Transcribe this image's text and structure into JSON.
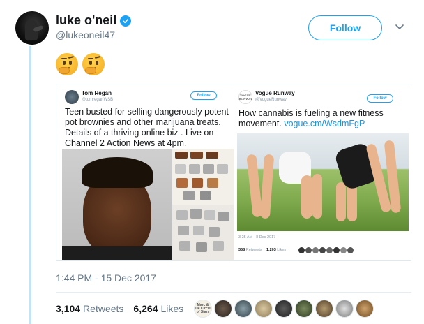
{
  "tweet": {
    "author_name": "luke o'neil",
    "author_handle": "@lukeoneil47",
    "follow_label": "Follow",
    "emojis": [
      "🤔",
      "🤔"
    ],
    "timestamp": "1:44 PM - 15 Dec 2017",
    "retweets_count": "3,104",
    "retweets_label": "Retweets",
    "likes_count": "6,264",
    "likes_label": "Likes",
    "liker_avatars": [
      "Marc & De Circle of Stars",
      "",
      "",
      "",
      "",
      "",
      "",
      "",
      "",
      ""
    ]
  },
  "embedded_left": {
    "name": "Tom Regan",
    "handle": "@tomreganWSB",
    "follow_label": "Follow",
    "text": "Teen busted for selling dangerously potent pot brownies and other marijuana treats. Details of a thriving online biz . Live on Channel 2 Action News at 4pm."
  },
  "embedded_right": {
    "name": "Vogue Runway",
    "handle": "@VogueRunway",
    "logo_text": "VOGUE RUNWAY",
    "follow_label": "Follow",
    "text": "How cannabis is fueling a new fitness movement.",
    "link": "vogue.cm/WsdmFgP",
    "meta_time": "3:25 AM - 8 Dec 2017",
    "retweets": "358",
    "retweets_label": "Retweets",
    "likes": "1,203",
    "likes_label": "Likes"
  },
  "colors": {
    "brand_blue": "#1da1f2",
    "thread_line": "#c4e4f6",
    "muted_text": "#657786"
  }
}
